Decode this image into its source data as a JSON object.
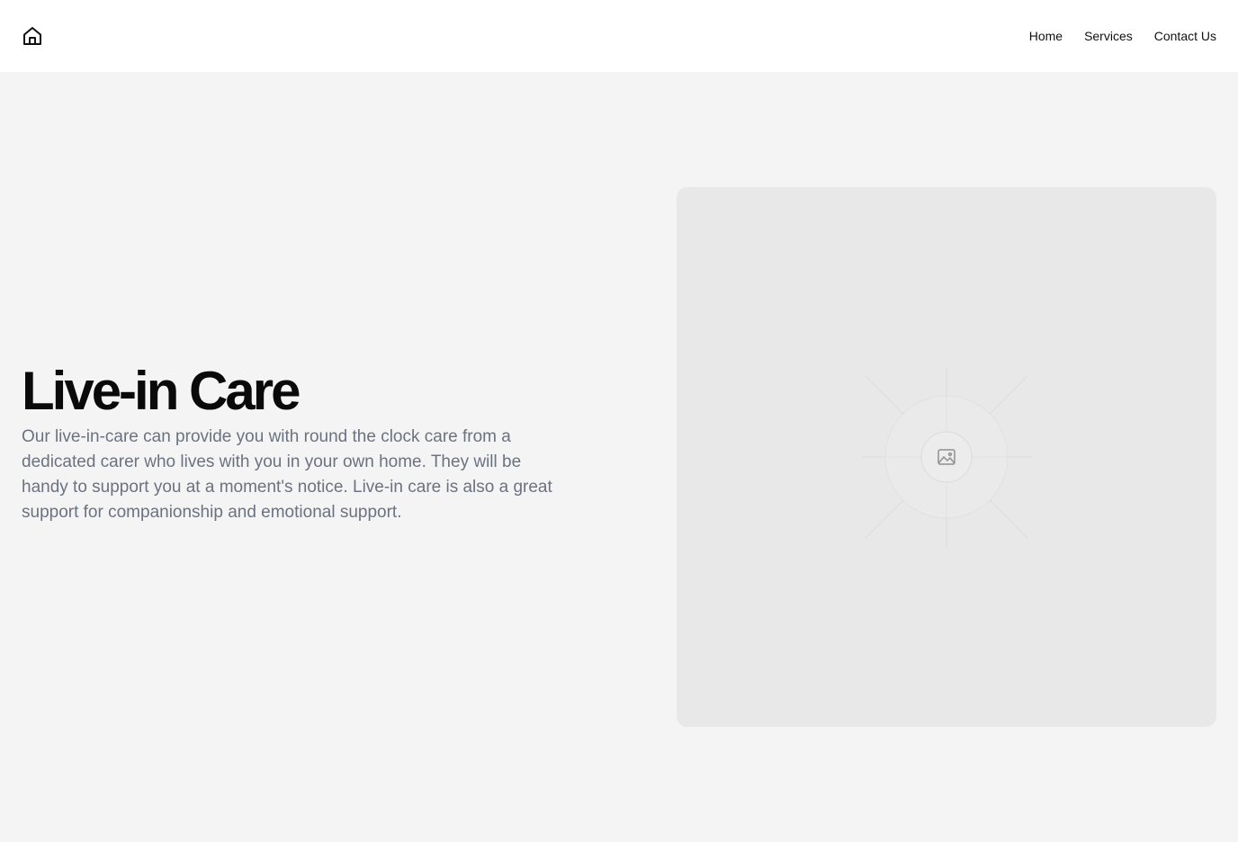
{
  "header": {
    "logo_icon": "home-icon",
    "nav": [
      {
        "label": "Home"
      },
      {
        "label": "Services"
      },
      {
        "label": "Contact Us"
      }
    ]
  },
  "hero": {
    "title": "Live-in Care",
    "description": "Our live-in-care can provide you with round the clock care from a dedicated carer who lives with you in your own home. They will be handy to support you at a moment's notice. Live-in care is also a great support for companionship and emotional support."
  },
  "media": {
    "icon": "image-icon"
  },
  "colors": {
    "page_background": "#f4f4f4",
    "header_background": "#ffffff",
    "title": "#0a0a0a",
    "body_text": "#6b7280",
    "placeholder": "#e8e8e8"
  }
}
